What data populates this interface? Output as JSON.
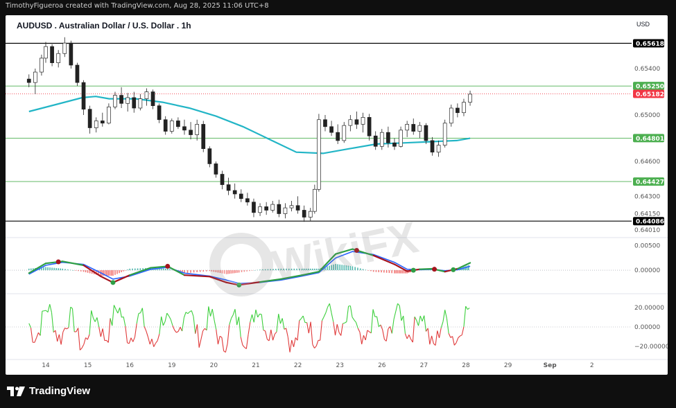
{
  "attribution": "TimothyFigueroa created with TradingView.com, Aug 28, 2025 11:06 UTC+8",
  "brand": "TradingView",
  "watermark": "WikiFX",
  "chart_data": {
    "type": "candlestick",
    "title": "AUDUSD . Australian Dollar / U.S. Dollar . 1h",
    "currency": "USD",
    "timeframe": "1h",
    "x_tick_labels": [
      "14",
      "15",
      "16",
      "19",
      "20",
      "21",
      "22",
      "23",
      "26",
      "27",
      "28",
      "29",
      "Sep",
      "2"
    ],
    "price_axis": {
      "ylim": [
        0.6395,
        0.658
      ],
      "tick_labels": [
        "0.65400",
        "0.65000",
        "0.64600",
        "0.64300",
        "0.64150",
        "0.64010"
      ],
      "tick_values": [
        0.654,
        0.65,
        0.646,
        0.643,
        0.6415,
        0.6401
      ]
    },
    "horizontal_levels": [
      {
        "label": "0.65618",
        "value": 0.65618,
        "line_color": "#000000",
        "badge_color": "#000000"
      },
      {
        "label": "0.65250",
        "value": 0.6525,
        "line_color": "#4caf50",
        "badge_color": "#4caf50"
      },
      {
        "label": "0.64801",
        "value": 0.64801,
        "line_color": "#4caf50",
        "badge_color": "#4caf50"
      },
      {
        "label": "0.64427",
        "value": 0.64427,
        "line_color": "#4caf50",
        "badge_color": "#4caf50"
      },
      {
        "label": "0.64086",
        "value": 0.64086,
        "line_color": "#000000",
        "badge_color": "#000000"
      }
    ],
    "last_price": {
      "label": "0.65182",
      "value": 0.65182,
      "color": "#f23645"
    },
    "moving_average": {
      "color": "#22b5c6",
      "points": [
        [
          0,
          0.6503
        ],
        [
          1,
          0.6509
        ],
        [
          2,
          0.6515
        ],
        [
          2.5,
          0.6516
        ],
        [
          3,
          0.6514
        ],
        [
          4,
          0.6514
        ],
        [
          5,
          0.6511
        ],
        [
          6,
          0.6506
        ],
        [
          7,
          0.6499
        ],
        [
          8,
          0.649
        ],
        [
          9,
          0.6479
        ],
        [
          10,
          0.6468
        ],
        [
          11,
          0.6467
        ],
        [
          12,
          0.6471
        ],
        [
          13,
          0.6475
        ],
        [
          14,
          0.6476
        ],
        [
          15,
          0.6477
        ],
        [
          16,
          0.6478
        ],
        [
          16.5,
          0.648
        ]
      ]
    },
    "candles": [
      {
        "day": 13.6,
        "o": 0.6531,
        "h": 0.6535,
        "l": 0.6524,
        "c": 0.6528
      },
      {
        "day": 13.75,
        "o": 0.6528,
        "h": 0.654,
        "l": 0.6518,
        "c": 0.6537
      },
      {
        "day": 13.9,
        "o": 0.6537,
        "h": 0.6552,
        "l": 0.6534,
        "c": 0.6549
      },
      {
        "day": 14.0,
        "o": 0.6549,
        "h": 0.6563,
        "l": 0.6545,
        "c": 0.6559
      },
      {
        "day": 14.15,
        "o": 0.6559,
        "h": 0.6561,
        "l": 0.6542,
        "c": 0.6545
      },
      {
        "day": 14.3,
        "o": 0.6545,
        "h": 0.6556,
        "l": 0.6541,
        "c": 0.6553
      },
      {
        "day": 14.45,
        "o": 0.6553,
        "h": 0.6567,
        "l": 0.655,
        "c": 0.6562
      },
      {
        "day": 14.6,
        "o": 0.6562,
        "h": 0.6564,
        "l": 0.654,
        "c": 0.6543
      },
      {
        "day": 14.75,
        "o": 0.6543,
        "h": 0.6545,
        "l": 0.6525,
        "c": 0.6528
      },
      {
        "day": 14.9,
        "o": 0.6528,
        "h": 0.653,
        "l": 0.65,
        "c": 0.6505
      },
      {
        "day": 15.05,
        "o": 0.6505,
        "h": 0.6508,
        "l": 0.6484,
        "c": 0.6489
      },
      {
        "day": 15.2,
        "o": 0.6489,
        "h": 0.6498,
        "l": 0.6485,
        "c": 0.6495
      },
      {
        "day": 15.35,
        "o": 0.6495,
        "h": 0.6502,
        "l": 0.649,
        "c": 0.6493
      },
      {
        "day": 15.5,
        "o": 0.6493,
        "h": 0.651,
        "l": 0.6492,
        "c": 0.6507
      },
      {
        "day": 15.65,
        "o": 0.6507,
        "h": 0.652,
        "l": 0.6505,
        "c": 0.6517
      },
      {
        "day": 15.8,
        "o": 0.6517,
        "h": 0.6524,
        "l": 0.6506,
        "c": 0.651
      },
      {
        "day": 15.95,
        "o": 0.651,
        "h": 0.6519,
        "l": 0.6503,
        "c": 0.6515
      },
      {
        "day": 16.1,
        "o": 0.6515,
        "h": 0.652,
        "l": 0.6502,
        "c": 0.6506
      },
      {
        "day": 16.25,
        "o": 0.6506,
        "h": 0.6518,
        "l": 0.6504,
        "c": 0.6514
      },
      {
        "day": 16.4,
        "o": 0.6514,
        "h": 0.6523,
        "l": 0.6508,
        "c": 0.652
      },
      {
        "day": 16.55,
        "o": 0.652,
        "h": 0.6522,
        "l": 0.6505,
        "c": 0.6508
      },
      {
        "day": 16.7,
        "o": 0.6508,
        "h": 0.651,
        "l": 0.6493,
        "c": 0.6496
      },
      {
        "day": 16.85,
        "o": 0.6496,
        "h": 0.6499,
        "l": 0.6483,
        "c": 0.6486
      },
      {
        "day": 17.0,
        "o": 0.6486,
        "h": 0.6497,
        "l": 0.6484,
        "c": 0.6495
      },
      {
        "day": 17.15,
        "o": 0.6495,
        "h": 0.6498,
        "l": 0.6488,
        "c": 0.649
      },
      {
        "day": 17.3,
        "o": 0.649,
        "h": 0.6496,
        "l": 0.6483,
        "c": 0.6487
      },
      {
        "day": 17.45,
        "o": 0.6487,
        "h": 0.6494,
        "l": 0.6479,
        "c": 0.6483
      },
      {
        "day": 17.6,
        "o": 0.6483,
        "h": 0.6496,
        "l": 0.6478,
        "c": 0.6492
      },
      {
        "day": 17.75,
        "o": 0.6492,
        "h": 0.6495,
        "l": 0.6468,
        "c": 0.6471
      },
      {
        "day": 17.9,
        "o": 0.6471,
        "h": 0.6473,
        "l": 0.6455,
        "c": 0.6458
      },
      {
        "day": 18.05,
        "o": 0.6458,
        "h": 0.646,
        "l": 0.6446,
        "c": 0.6449
      },
      {
        "day": 18.2,
        "o": 0.6449,
        "h": 0.6452,
        "l": 0.6436,
        "c": 0.644
      },
      {
        "day": 18.35,
        "o": 0.644,
        "h": 0.6446,
        "l": 0.6431,
        "c": 0.6435
      },
      {
        "day": 18.5,
        "o": 0.6435,
        "h": 0.6441,
        "l": 0.6428,
        "c": 0.6432
      },
      {
        "day": 18.65,
        "o": 0.6432,
        "h": 0.6436,
        "l": 0.6425,
        "c": 0.6428
      },
      {
        "day": 18.8,
        "o": 0.6428,
        "h": 0.6433,
        "l": 0.6422,
        "c": 0.6425
      },
      {
        "day": 18.95,
        "o": 0.6425,
        "h": 0.6428,
        "l": 0.6412,
        "c": 0.6416
      },
      {
        "day": 19.1,
        "o": 0.6416,
        "h": 0.6424,
        "l": 0.6413,
        "c": 0.6421
      },
      {
        "day": 19.25,
        "o": 0.6421,
        "h": 0.6425,
        "l": 0.6414,
        "c": 0.6418
      },
      {
        "day": 19.4,
        "o": 0.6418,
        "h": 0.6426,
        "l": 0.6416,
        "c": 0.6423
      },
      {
        "day": 19.55,
        "o": 0.6423,
        "h": 0.6427,
        "l": 0.6412,
        "c": 0.6415
      },
      {
        "day": 19.7,
        "o": 0.6415,
        "h": 0.6424,
        "l": 0.6411,
        "c": 0.642
      },
      {
        "day": 19.85,
        "o": 0.642,
        "h": 0.6426,
        "l": 0.6417,
        "c": 0.6422
      },
      {
        "day": 20.0,
        "o": 0.6422,
        "h": 0.643,
        "l": 0.6415,
        "c": 0.6418
      },
      {
        "day": 20.15,
        "o": 0.6418,
        "h": 0.6422,
        "l": 0.6408,
        "c": 0.6412
      },
      {
        "day": 20.3,
        "o": 0.6412,
        "h": 0.642,
        "l": 0.6409,
        "c": 0.6417
      },
      {
        "day": 20.4,
        "o": 0.6417,
        "h": 0.644,
        "l": 0.6415,
        "c": 0.6436
      },
      {
        "day": 20.5,
        "o": 0.6436,
        "h": 0.6501,
        "l": 0.6434,
        "c": 0.6496
      },
      {
        "day": 20.65,
        "o": 0.6496,
        "h": 0.65,
        "l": 0.6486,
        "c": 0.649
      },
      {
        "day": 20.8,
        "o": 0.649,
        "h": 0.6495,
        "l": 0.6482,
        "c": 0.6485
      },
      {
        "day": 20.95,
        "o": 0.6485,
        "h": 0.6492,
        "l": 0.6475,
        "c": 0.6478
      },
      {
        "day": 21.1,
        "o": 0.6478,
        "h": 0.6494,
        "l": 0.6476,
        "c": 0.6491
      },
      {
        "day": 21.25,
        "o": 0.6491,
        "h": 0.65,
        "l": 0.6486,
        "c": 0.6496
      },
      {
        "day": 21.4,
        "o": 0.6496,
        "h": 0.6503,
        "l": 0.6488,
        "c": 0.6492
      },
      {
        "day": 21.55,
        "o": 0.6492,
        "h": 0.6502,
        "l": 0.6485,
        "c": 0.6498
      },
      {
        "day": 21.7,
        "o": 0.6498,
        "h": 0.6501,
        "l": 0.6478,
        "c": 0.6482
      },
      {
        "day": 21.85,
        "o": 0.6482,
        "h": 0.6486,
        "l": 0.647,
        "c": 0.6473
      },
      {
        "day": 22.0,
        "o": 0.6473,
        "h": 0.6488,
        "l": 0.647,
        "c": 0.6485
      },
      {
        "day": 22.15,
        "o": 0.6485,
        "h": 0.649,
        "l": 0.6472,
        "c": 0.6476
      },
      {
        "day": 22.3,
        "o": 0.6476,
        "h": 0.648,
        "l": 0.647,
        "c": 0.6473
      },
      {
        "day": 22.45,
        "o": 0.6473,
        "h": 0.649,
        "l": 0.6472,
        "c": 0.6487
      },
      {
        "day": 22.6,
        "o": 0.6487,
        "h": 0.6495,
        "l": 0.6481,
        "c": 0.6492
      },
      {
        "day": 22.75,
        "o": 0.6492,
        "h": 0.6497,
        "l": 0.6483,
        "c": 0.6486
      },
      {
        "day": 22.9,
        "o": 0.6486,
        "h": 0.6494,
        "l": 0.648,
        "c": 0.6491
      },
      {
        "day": 23.05,
        "o": 0.6491,
        "h": 0.6493,
        "l": 0.6475,
        "c": 0.6478
      },
      {
        "day": 23.2,
        "o": 0.6478,
        "h": 0.6481,
        "l": 0.6465,
        "c": 0.6468
      },
      {
        "day": 23.35,
        "o": 0.6468,
        "h": 0.6478,
        "l": 0.6464,
        "c": 0.6474
      },
      {
        "day": 23.5,
        "o": 0.6474,
        "h": 0.6496,
        "l": 0.6472,
        "c": 0.6493
      },
      {
        "day": 23.65,
        "o": 0.6493,
        "h": 0.6509,
        "l": 0.649,
        "c": 0.6506
      },
      {
        "day": 23.8,
        "o": 0.6506,
        "h": 0.651,
        "l": 0.6498,
        "c": 0.6502
      },
      {
        "day": 23.95,
        "o": 0.6502,
        "h": 0.6514,
        "l": 0.6499,
        "c": 0.6511
      },
      {
        "day": 24.1,
        "o": 0.6511,
        "h": 0.6521,
        "l": 0.6508,
        "c": 0.6518
      }
    ],
    "macd": {
      "tick_labels": [
        "0.00500",
        "0.00000"
      ],
      "tick_values": [
        0.005,
        0.0
      ],
      "ylim": [
        -0.0045,
        0.0065
      ],
      "macd_line": [
        [
          13.6,
          -0.0006
        ],
        [
          14.0,
          0.0014
        ],
        [
          14.4,
          0.0018
        ],
        [
          14.9,
          0.001
        ],
        [
          15.3,
          -0.0012
        ],
        [
          15.6,
          -0.0025
        ],
        [
          16.0,
          -0.001
        ],
        [
          16.5,
          0.0005
        ],
        [
          16.9,
          0.0008
        ],
        [
          17.3,
          -0.001
        ],
        [
          17.9,
          -0.0013
        ],
        [
          18.3,
          -0.0025
        ],
        [
          18.6,
          -0.003
        ],
        [
          19.1,
          -0.0024
        ],
        [
          19.6,
          -0.0018
        ],
        [
          20.1,
          -0.001
        ],
        [
          20.5,
          -0.0003
        ],
        [
          20.9,
          0.0033
        ],
        [
          21.3,
          0.0043
        ],
        [
          21.8,
          0.003
        ],
        [
          22.3,
          0.0012
        ],
        [
          22.6,
          -0.0002
        ],
        [
          22.9,
          0.0002
        ],
        [
          23.2,
          0.0003
        ],
        [
          23.5,
          -0.0003
        ],
        [
          23.8,
          0.0003
        ],
        [
          24.1,
          0.0015
        ]
      ],
      "signal_line": [
        [
          13.6,
          -0.0008
        ],
        [
          14.0,
          0.001
        ],
        [
          14.4,
          0.0016
        ],
        [
          14.9,
          0.0012
        ],
        [
          15.3,
          -0.0005
        ],
        [
          15.6,
          -0.0018
        ],
        [
          16.0,
          -0.0012
        ],
        [
          16.5,
          0.0002
        ],
        [
          16.9,
          0.0006
        ],
        [
          17.3,
          -0.0006
        ],
        [
          17.9,
          -0.0012
        ],
        [
          18.3,
          -0.002
        ],
        [
          18.6,
          -0.0027
        ],
        [
          19.1,
          -0.0025
        ],
        [
          19.6,
          -0.002
        ],
        [
          20.1,
          -0.0012
        ],
        [
          20.5,
          -0.0005
        ],
        [
          20.9,
          0.0025
        ],
        [
          21.3,
          0.0038
        ],
        [
          21.8,
          0.0032
        ],
        [
          22.3,
          0.0016
        ],
        [
          22.6,
          0.0002
        ],
        [
          22.9,
          0.0001
        ],
        [
          23.2,
          0.0002
        ],
        [
          23.5,
          -0.0001
        ],
        [
          23.8,
          0.0001
        ],
        [
          24.1,
          0.0008
        ]
      ],
      "cross_up_days": [
        15.6,
        18.6,
        22.75,
        23.7
      ],
      "cross_down_days": [
        14.3,
        16.9,
        21.4,
        23.25
      ],
      "colors": {
        "macd_up": "#2e9f45",
        "macd_down": "#a6141e",
        "signal": "#2962ff"
      }
    },
    "rsi_oscillator": {
      "tick_labels": [
        "20.00000",
        "0.00000",
        "−20.00000"
      ],
      "tick_values": [
        20,
        0,
        -20
      ],
      "ylim": [
        -32,
        32
      ],
      "colors": {
        "positive": "#3ccf3c",
        "negative": "#e03a3a"
      }
    }
  }
}
